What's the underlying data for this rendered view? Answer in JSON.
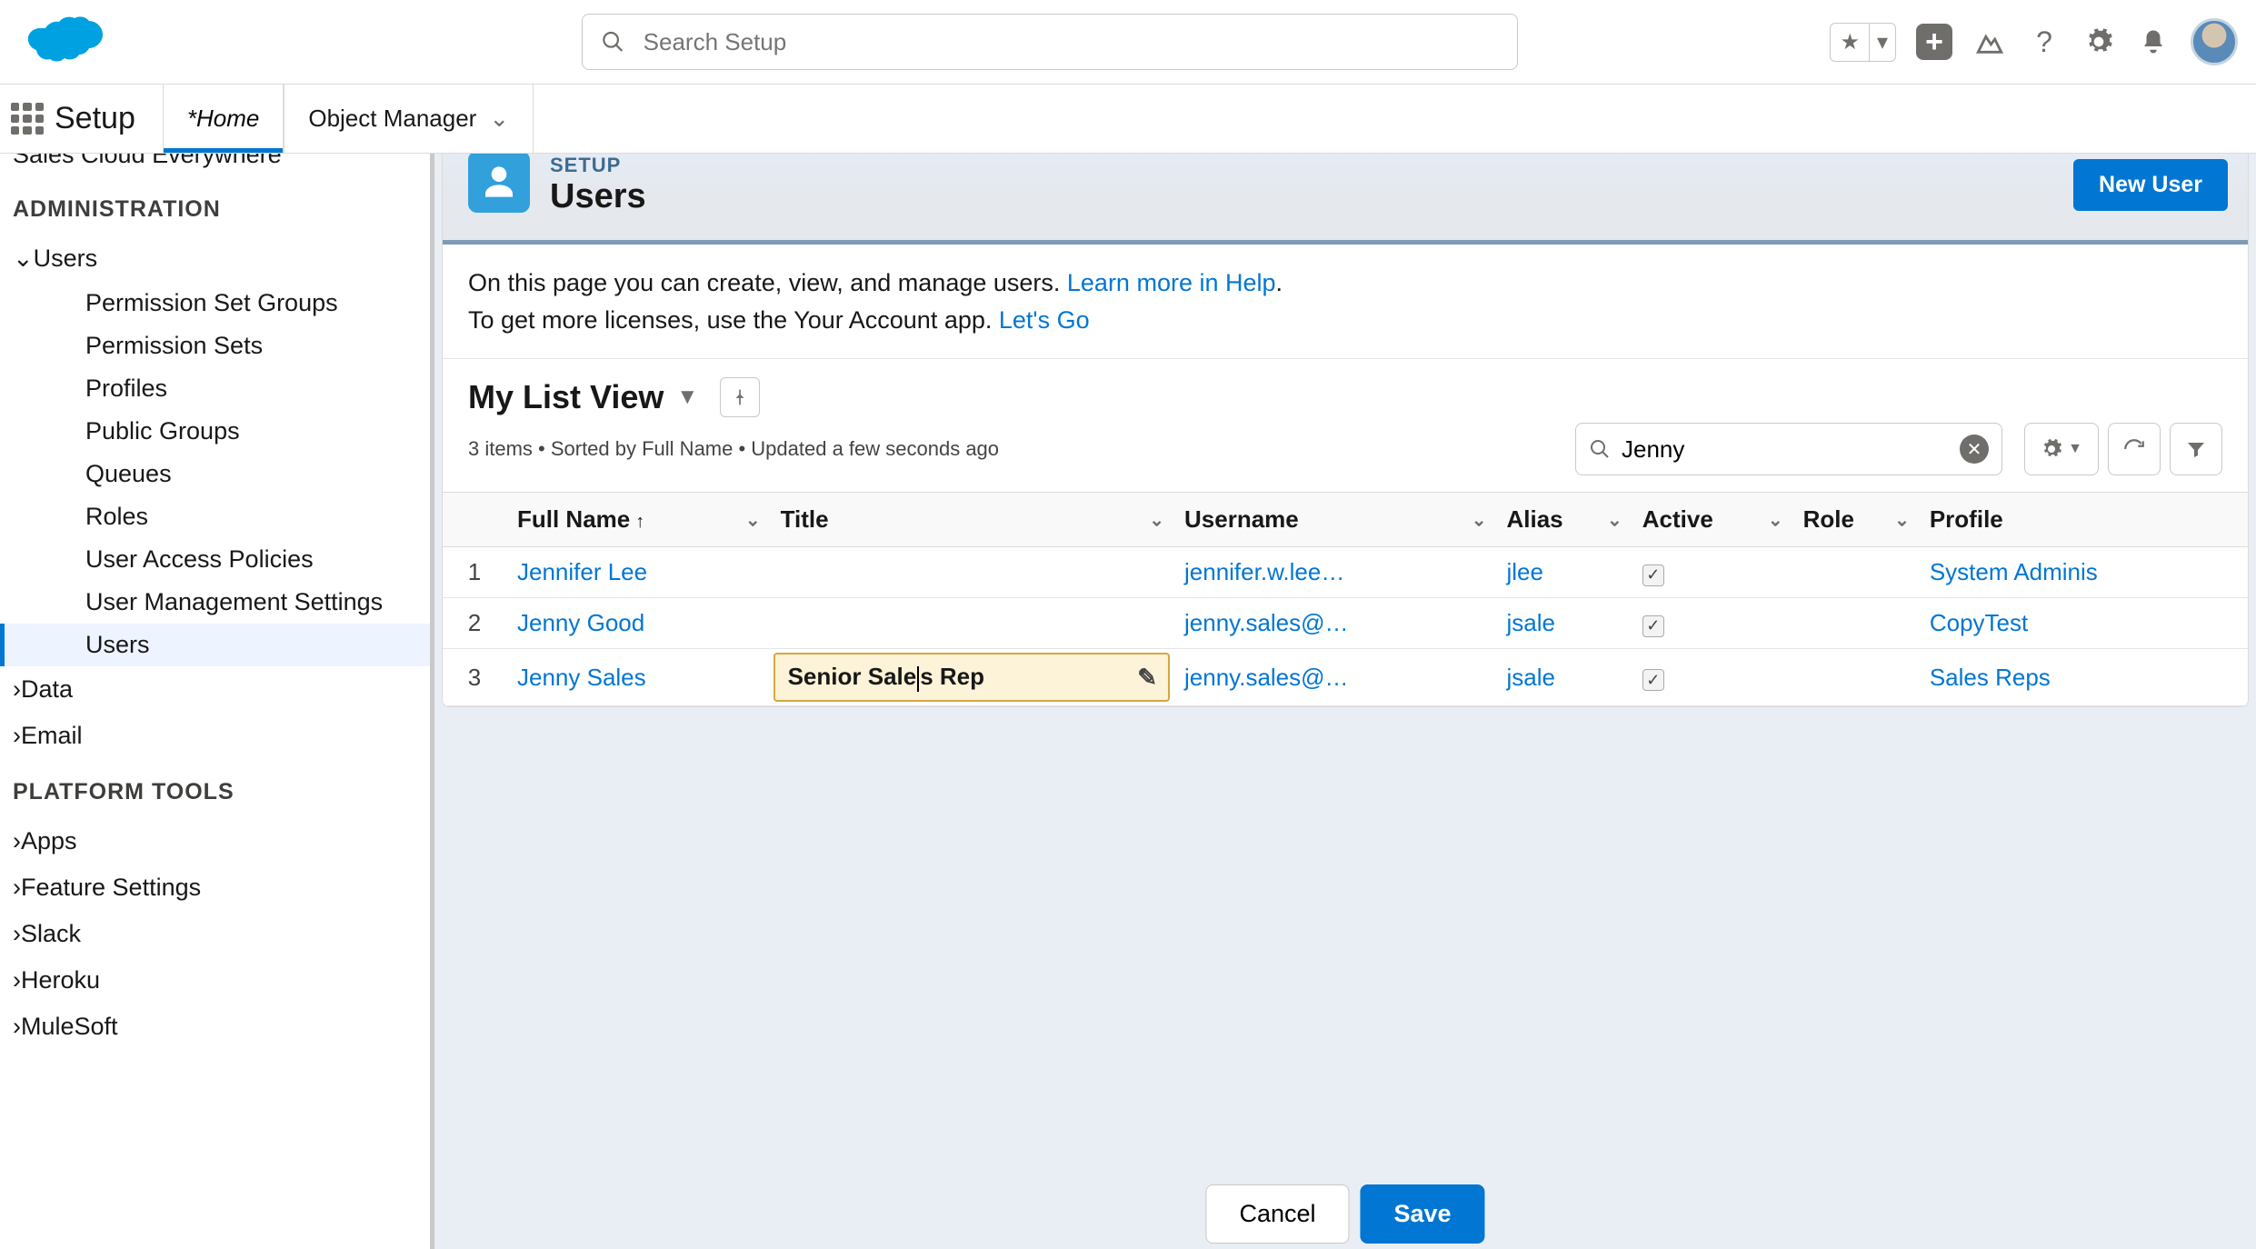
{
  "header": {
    "search_placeholder": "Search Setup"
  },
  "nav": {
    "app_name": "Setup",
    "tabs": [
      {
        "label": "*Home",
        "active": true,
        "has_dropdown": false
      },
      {
        "label": "Object Manager",
        "active": false,
        "has_dropdown": true
      }
    ]
  },
  "sidebar": {
    "truncated_top": "Sales Cloud Everywhere",
    "sections": [
      {
        "heading": "ADMINISTRATION",
        "items": [
          {
            "label": "Users",
            "expanded": true,
            "children": [
              {
                "label": "Permission Set Groups"
              },
              {
                "label": "Permission Sets"
              },
              {
                "label": "Profiles"
              },
              {
                "label": "Public Groups"
              },
              {
                "label": "Queues"
              },
              {
                "label": "Roles"
              },
              {
                "label": "User Access Policies"
              },
              {
                "label": "User Management Settings"
              },
              {
                "label": "Users",
                "active": true
              }
            ]
          },
          {
            "label": "Data",
            "expanded": false
          },
          {
            "label": "Email",
            "expanded": false
          }
        ]
      },
      {
        "heading": "PLATFORM TOOLS",
        "items": [
          {
            "label": "Apps",
            "expanded": false
          },
          {
            "label": "Feature Settings",
            "expanded": false
          },
          {
            "label": "Slack",
            "expanded": false
          },
          {
            "label": "Heroku",
            "expanded": false
          },
          {
            "label": "MuleSoft",
            "expanded": false
          }
        ]
      }
    ]
  },
  "page": {
    "crumb": "SETUP",
    "title": "Users",
    "new_user_label": "New User",
    "info_line1_pre": "On this page you can create, view, and manage users. ",
    "info_link1": "Learn more in Help",
    "info_line1_post": ".",
    "info_line2_pre": "To get more licenses, use the Your Account app. ",
    "info_link2": "Let's Go"
  },
  "list": {
    "view_name": "My List View",
    "meta": "3 items • Sorted by Full Name • Updated a few seconds ago",
    "search_value": "Jenny",
    "columns": [
      "Full Name",
      "Title",
      "Username",
      "Alias",
      "Active",
      "Role",
      "Profile"
    ],
    "sort_col": "Full Name",
    "sort_dir": "asc",
    "rows": [
      {
        "num": "1",
        "full_name": "Jennifer Lee",
        "title": "",
        "username": "jennifer.w.lee…",
        "alias": "jlee",
        "active": true,
        "role": "",
        "profile": "System Adminis"
      },
      {
        "num": "2",
        "full_name": "Jenny Good",
        "title": "",
        "username": "jenny.sales@…",
        "alias": "jsale",
        "active": true,
        "role": "",
        "profile": "CopyTest"
      },
      {
        "num": "3",
        "full_name": "Jenny Sales",
        "title": "Senior Sales Rep",
        "title_editing": true,
        "username": "jenny.sales@…",
        "alias": "jsale",
        "active": true,
        "role": "",
        "profile": "Sales Reps"
      }
    ]
  },
  "footer": {
    "cancel": "Cancel",
    "save": "Save"
  }
}
